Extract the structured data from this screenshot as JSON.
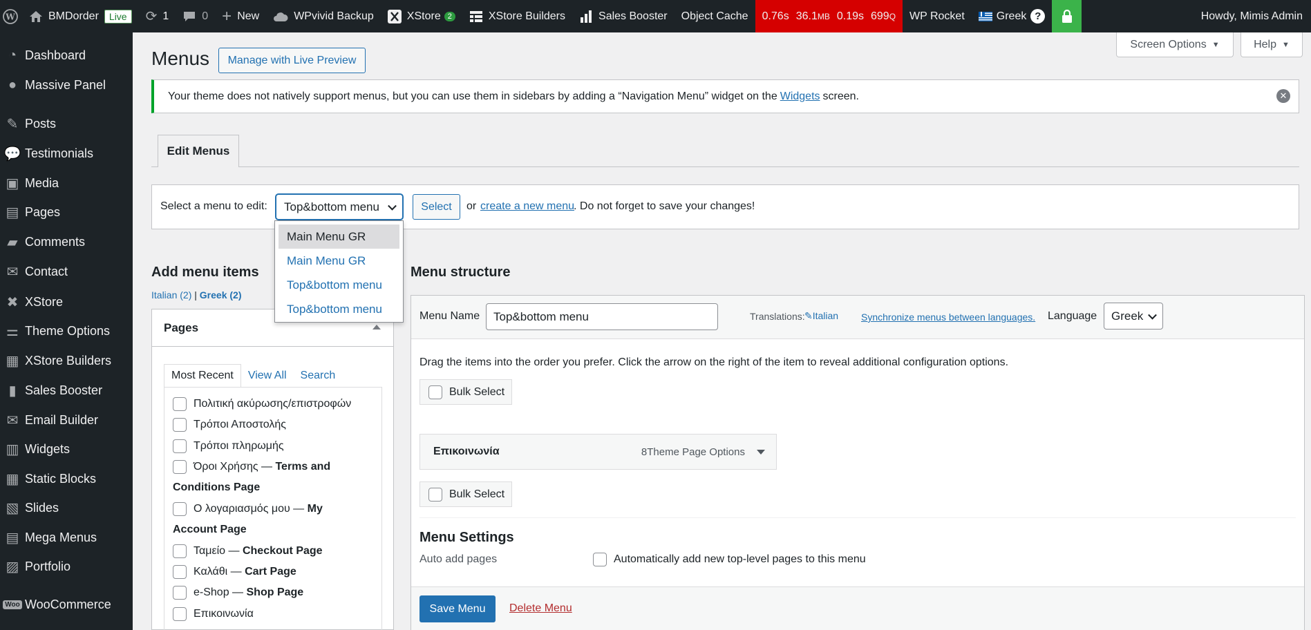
{
  "adminbar": {
    "site_name": "BMDorder",
    "live_badge": "Live",
    "updates_count": "1",
    "comments_count": "0",
    "new_label": "New",
    "wpvivid": "WPvivid Backup",
    "xstore": "XStore",
    "xstore_badge": "2",
    "xstore_builders": "XStore Builders",
    "sales_booster": "Sales Booster",
    "object_cache": "Object Cache",
    "perf": {
      "t1": "0.76s",
      "mem": "36.1",
      "mem_unit": "MB",
      "t2": "0.19s",
      "queries": "699",
      "queries_unit": "Q"
    },
    "wp_rocket": "WP Rocket",
    "language": "Greek",
    "help_mark": "?",
    "greeting": "Howdy, Mimis Admin"
  },
  "sidebar": {
    "items": [
      {
        "label": "Dashboard",
        "icon": "dashboard-icon"
      },
      {
        "label": "Massive Panel",
        "icon": "lightbulb-icon"
      },
      {
        "label": "Posts",
        "icon": "pin-icon"
      },
      {
        "label": "Testimonials",
        "icon": "speech-icon"
      },
      {
        "label": "Media",
        "icon": "media-icon"
      },
      {
        "label": "Pages",
        "icon": "pages-icon"
      },
      {
        "label": "Comments",
        "icon": "comment-icon"
      },
      {
        "label": "Contact",
        "icon": "mail-icon"
      },
      {
        "label": "XStore",
        "icon": "xstore-icon"
      },
      {
        "label": "Theme Options",
        "icon": "sliders-icon"
      },
      {
        "label": "XStore Builders",
        "icon": "grid-icon"
      },
      {
        "label": "Sales Booster",
        "icon": "bars-icon"
      },
      {
        "label": "Email Builder",
        "icon": "mail-icon"
      },
      {
        "label": "Widgets",
        "icon": "widgets-icon"
      },
      {
        "label": "Static Blocks",
        "icon": "blocks-icon"
      },
      {
        "label": "Slides",
        "icon": "slides-icon"
      },
      {
        "label": "Mega Menus",
        "icon": "megamenu-icon"
      },
      {
        "label": "Portfolio",
        "icon": "portfolio-icon"
      },
      {
        "label": "WooCommerce",
        "icon": "woo-icon"
      }
    ]
  },
  "screen_options": "Screen Options",
  "help": "Help",
  "page_title": "Menus",
  "live_preview_btn": "Manage with Live Preview",
  "notice": {
    "before": "Your theme does not natively support menus, but you can use them in sidebars by adding a “Navigation Menu” widget on the",
    "link": "Widgets",
    "after": "screen."
  },
  "edit_tab": "Edit Menus",
  "select_menu": {
    "label": "Select a menu to edit:",
    "selected": "Top&bottom menu",
    "button": "Select",
    "or": "or",
    "create_link": "create a new menu",
    "reminder": ". Do not forget to save your changes!",
    "options": [
      "Main Menu GR",
      "Main Menu GR",
      "Top&bottom menu",
      "Top&bottom menu"
    ]
  },
  "add_items": {
    "title": "Add menu items",
    "lang_italian": "Italian (2)",
    "lang_sep": "|",
    "lang_greek": "Greek (2)",
    "box_title": "Pages",
    "tabs": [
      "Most Recent",
      "View All",
      "Search"
    ],
    "pages": [
      {
        "name": "Πολιτική ακύρωσης/επιστροφών",
        "suffix": ""
      },
      {
        "name": "Τρόποι Αποστολής",
        "suffix": ""
      },
      {
        "name": "Τρόποι πληρωμής",
        "suffix": ""
      },
      {
        "name": "Όροι Χρήσης —",
        "suffix": "Terms and Conditions Page"
      },
      {
        "name": "Ο λογαριασμός μου —",
        "suffix": "My Account Page"
      },
      {
        "name": "Ταμείο —",
        "suffix": "Checkout Page"
      },
      {
        "name": "Καλάθι —",
        "suffix": "Cart Page"
      },
      {
        "name": "e-Shop —",
        "suffix": "Shop Page"
      },
      {
        "name": "Επικοινωνία",
        "suffix": ""
      }
    ]
  },
  "structure": {
    "title": "Menu structure",
    "name_label": "Menu Name",
    "name_value": "Top&bottom menu",
    "translations_label": "Translations:",
    "translation_link": "Italian",
    "sync_link": "Synchronize menus between languages.",
    "language_label": "Language",
    "language_value": "Greek",
    "instructions": "Drag the items into the order you prefer. Click the arrow on the right of the item to reveal additional configuration options.",
    "bulk_select": "Bulk Select",
    "item_title": "Επικοινωνία",
    "item_type": "8Theme Page Options",
    "settings_title": "Menu Settings",
    "auto_add_label": "Auto add pages",
    "auto_add_option": "Automatically add new top-level pages to this menu",
    "save_btn": "Save Menu",
    "delete_link": "Delete Menu"
  }
}
